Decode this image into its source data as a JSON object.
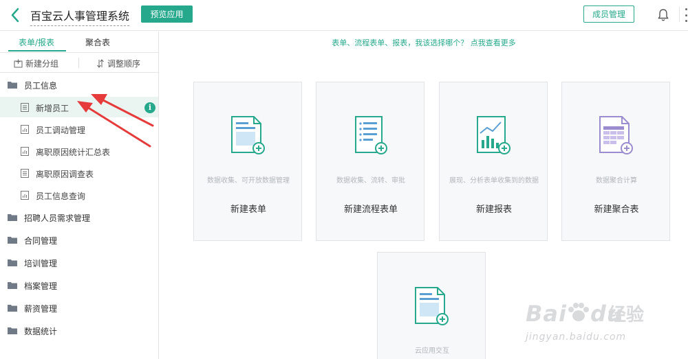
{
  "header": {
    "title": "百宝云人事管理系统",
    "preview_label": "预览应用",
    "members_label": "成员管理"
  },
  "colors": {
    "accent": "#25a88c",
    "arrow": "#e53b3b"
  },
  "sidebar": {
    "tabs": [
      {
        "label": "表单/报表",
        "active": true
      },
      {
        "label": "聚合表",
        "active": false
      }
    ],
    "tools": {
      "new_group": "新建分组",
      "reorder": "调整顺序"
    },
    "groups": [
      {
        "label": "员工信息",
        "icon": "folder-icon",
        "items": [
          {
            "label": "新增员工",
            "icon": "form-icon",
            "active": true,
            "badge": "i"
          },
          {
            "label": "员工调动管理",
            "icon": "report-icon"
          },
          {
            "label": "离职原因统计汇总表",
            "icon": "report-icon"
          },
          {
            "label": "离职原因调查表",
            "icon": "form-icon"
          },
          {
            "label": "员工信息查询",
            "icon": "report-icon"
          }
        ]
      },
      {
        "label": "招聘人员需求管理",
        "icon": "folder-icon"
      },
      {
        "label": "合同管理",
        "icon": "folder-icon"
      },
      {
        "label": "培训管理",
        "icon": "folder-icon"
      },
      {
        "label": "档案管理",
        "icon": "folder-icon"
      },
      {
        "label": "薪资管理",
        "icon": "folder-icon"
      },
      {
        "label": "数据统计",
        "icon": "folder-icon"
      }
    ]
  },
  "main": {
    "hint": "表单、流程表单、报表，我该选择哪个？ 点我查看更多",
    "cards": [
      {
        "name": "新建表单",
        "desc": "数据收集、可开放数据管理",
        "icon": "new-form-icon"
      },
      {
        "name": "新建流程表单",
        "desc": "数据收集、流转、审批",
        "icon": "new-workflow-form-icon"
      },
      {
        "name": "新建报表",
        "desc": "展现、分析表单收集到的数据",
        "icon": "new-report-icon"
      },
      {
        "name": "新建聚合表",
        "desc": "数据聚合计算",
        "icon": "new-aggregate-table-icon"
      },
      {
        "name": "",
        "desc": "云应用交互",
        "icon": "cloud-app-interaction-icon"
      }
    ]
  },
  "watermark": {
    "brand": "Bai",
    "brand2": "du",
    "cn": "经验",
    "url": "jingyan.baidu.com"
  }
}
